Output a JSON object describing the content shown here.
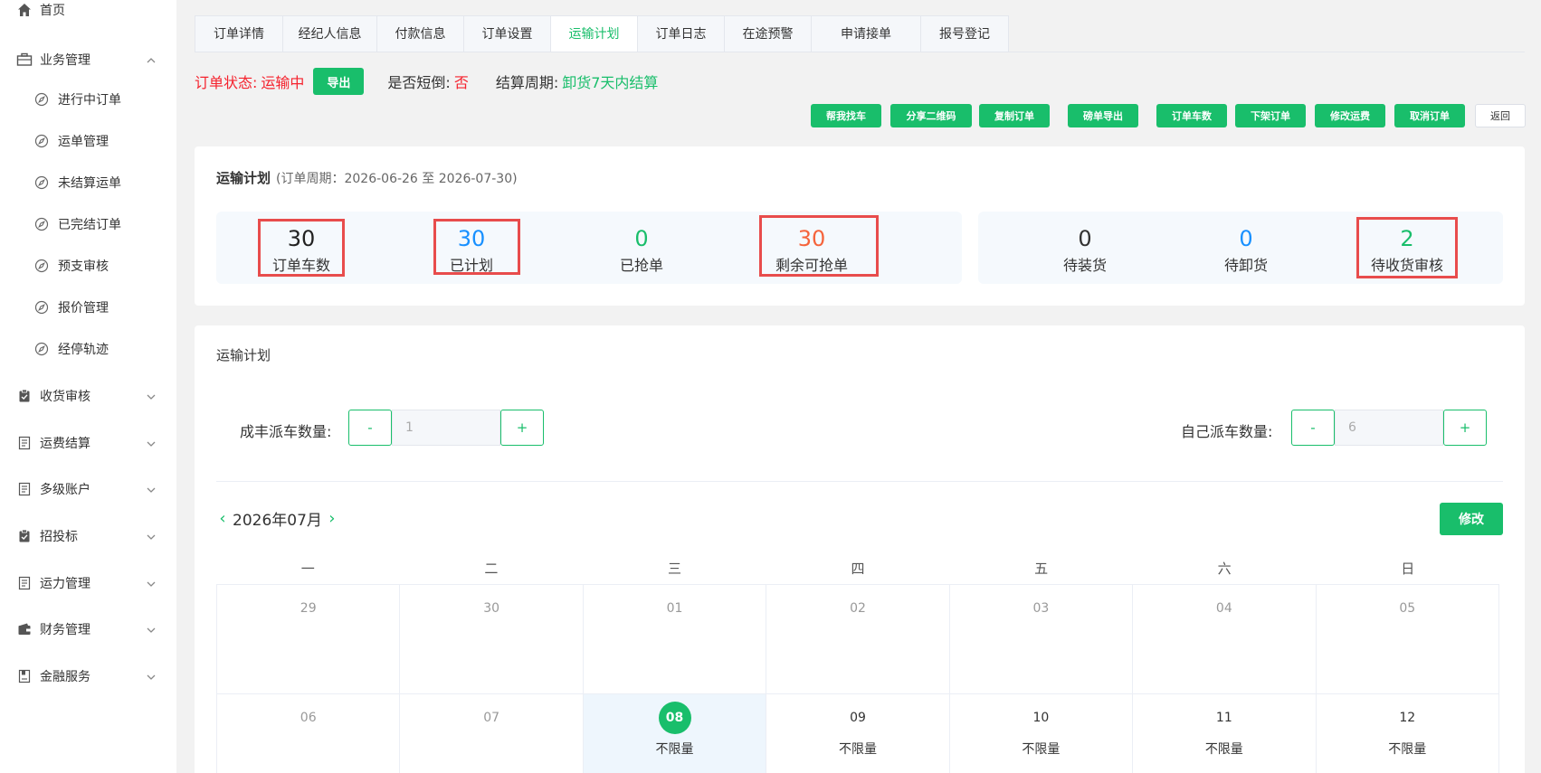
{
  "sidebar": {
    "home": "首页",
    "business": "业务管理",
    "sub": [
      "进行中订单",
      "运单管理",
      "未结算运单",
      "已完结订单",
      "预支审核",
      "报价管理",
      "经停轨迹"
    ],
    "groups": [
      "收货审核",
      "运费结算",
      "多级账户",
      "招投标",
      "运力管理",
      "财务管理",
      "金融服务"
    ]
  },
  "tabs": [
    "订单详情",
    "经纪人信息",
    "付款信息",
    "订单设置",
    "运输计划",
    "订单日志",
    "在途预警",
    "申请接单",
    "报号登记"
  ],
  "status": {
    "label": "订单状态:",
    "value": "运输中",
    "export": "导出",
    "short_label": "是否短倒:",
    "short_value": "否",
    "cycle_label": "结算周期:",
    "cycle_value": "卸货7天内结算"
  },
  "actions": [
    "帮我找车",
    "分享二维码",
    "复制订单",
    "磅单导出",
    "订单车数",
    "下架订单",
    "修改运费",
    "取消订单",
    "返回"
  ],
  "plan": {
    "title": "运输计划",
    "period": "(订单周期：2026-06-26 至 2026-07-30)",
    "stats": [
      {
        "num": "30",
        "label": "订单车数"
      },
      {
        "num": "30",
        "label": "已计划"
      },
      {
        "num": "0",
        "label": "已抢单"
      },
      {
        "num": "30",
        "label": "剩余可抢单"
      },
      {
        "num": "0",
        "label": "待装货"
      },
      {
        "num": "0",
        "label": "待卸货"
      },
      {
        "num": "2",
        "label": "待收货审核"
      }
    ]
  },
  "schedule": {
    "title": "运输计划",
    "cf_label": "成丰派车数量:",
    "cf_value": "1",
    "self_label": "自己派车数量:",
    "self_value": "6",
    "minus": "-",
    "plus": "+",
    "month": "2026年07月",
    "prev": "‹",
    "next": "›",
    "edit": "修改",
    "weekdays": [
      "一",
      "二",
      "三",
      "四",
      "五",
      "六",
      "日"
    ],
    "weeks": [
      [
        {
          "d": "29"
        },
        {
          "d": "30"
        },
        {
          "d": "01"
        },
        {
          "d": "02"
        },
        {
          "d": "03"
        },
        {
          "d": "04"
        },
        {
          "d": "05"
        }
      ],
      [
        {
          "d": "06"
        },
        {
          "d": "07"
        },
        {
          "d": "08",
          "q": "不限量"
        },
        {
          "d": "09",
          "q": "不限量"
        },
        {
          "d": "10",
          "q": "不限量"
        },
        {
          "d": "11",
          "q": "不限量"
        },
        {
          "d": "12",
          "q": "不限量"
        }
      ]
    ]
  },
  "colors": {
    "accent": "#19be6b",
    "danger": "#f5222d",
    "blue": "#1890ff",
    "orange_red": "#f5643c",
    "highlight": "#e84c4c"
  }
}
